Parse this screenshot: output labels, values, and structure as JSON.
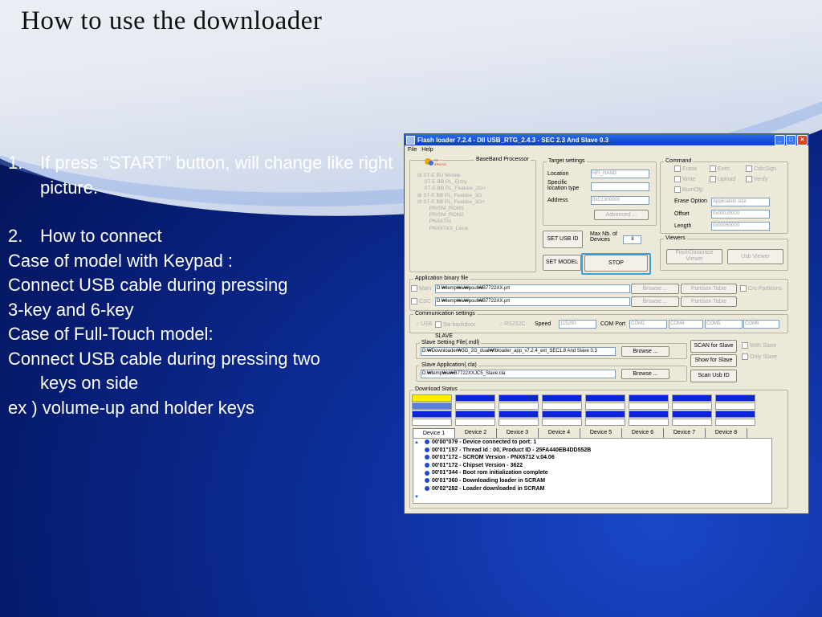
{
  "slide": {
    "title": "How to use the downloader",
    "item1_num": "1.",
    "item1_text": "If press “START” button, will change like right picture.",
    "item2_num": "2.",
    "item2_text": "How to connect",
    "lines": [
      "Case of model with Keypad :",
      "Connect USB cable during pressing",
      "3-key and 6-key",
      "Case of Full-Touch model:",
      "Connect USB cable during pressing two"
    ],
    "line_indent": "keys on side",
    "line_last": "ex ) volume-up and holder keys"
  },
  "window": {
    "title": "Flash loader 7.2.4 - Dll USB_RTG_2.4.3 - SEC 2.3 And Slave 0.3",
    "menu": [
      "File",
      "Help"
    ],
    "logo_text": "ST ERICSSON",
    "baseband_label": "BaseBand Processor",
    "tree": [
      "⊟ ST-E BU Mobile",
      "  ST-E BB PL_Entry",
      "  ST-E BB PL_Feature_2G+",
      "⊞ ST-E BB PL_Feature_3G",
      "⊟ ST-E BB PL_Feature_3G+",
      "   PRISM_ROM1",
      "   PRISM_ROM2",
      "   PNX6701",
      "   PNX67XX_Linux"
    ],
    "target": {
      "label": "Target settings",
      "location_label": "Location",
      "location_value": "NFI_NAND",
      "specific_label": "Specific location type",
      "address_label": "Address",
      "address_value": "0xC1300000",
      "advanced": "Advanced ..."
    },
    "command": {
      "label": "Command",
      "erase": "Erase",
      "exec": "Exec",
      "calcsign": "CalcSign",
      "write": "Write",
      "upload": "Upload",
      "verify": "Verify",
      "burnotp": "BurnOtp",
      "erase_option_label": "Erase Option",
      "erase_option_value": "Application size",
      "offset_label": "Offset",
      "offset_value": "0x00020000",
      "length_label": "Length",
      "length_value": "0x00060000"
    },
    "set_usb_id": "SET USB ID",
    "max_devices_label": "Max Nb. of Devices",
    "max_devices_value": "8",
    "set_model": "SET MODEL",
    "stop": "STOP",
    "viewers": {
      "label": "Viewers",
      "flash_db": "FlashDatabase Viewer",
      "usb_viewer": "Usb Viewer"
    },
    "app_binary": {
      "label": "Application binary file",
      "main_label": "Main",
      "main_path": "D:₩temp₩a₩pout₩B7722XX.prt",
      "csc_label": "CSC",
      "csc_path": "D:₩temp₩a₩pout₩B7722XX.prt",
      "browse": "Browse ...",
      "partition_table": "Partition Table",
      "crc": "Crc Partitions"
    },
    "comm": {
      "label": "Communication settings",
      "usb": "USB",
      "sw_backdoor": "Sw backdoor",
      "rs232c": "RS232C",
      "speed_label": "Speed",
      "speed_value": "115200",
      "com_port_label": "COM Port",
      "ports": [
        "COM1",
        "COM4",
        "COM5",
        "COM6"
      ]
    },
    "slave": {
      "label": "SLAVE",
      "setting_label": "Slave Setting File(.mdl)",
      "setting_path": "D:₩Downloader₩3G_2G_dual₩fbloader_app_v7.2.4_ext_SEC1.8 And Slave 0.3",
      "app_label": "Slave Application(.cla)",
      "app_path": "D:₩temp₩a₩B7722XXJC5_Slave.cla",
      "browse": "Browse ...",
      "scan_for_slave": "SCAN for Slave",
      "show_for_slave": "Show for Slave",
      "scan_usb_id": "Scan Usb ID",
      "with_slave": "With Slave",
      "only_slave": "Only Slave"
    },
    "download_status_label": "Download Status",
    "progress": {
      "row1": [
        "yellow",
        "blue",
        "blue",
        "blue",
        "blue",
        "blue",
        "blue",
        "blue"
      ],
      "row2": [
        "lblue",
        "empty",
        "empty",
        "empty",
        "empty",
        "empty",
        "empty",
        "empty"
      ],
      "row3": [
        "blue",
        "blue",
        "blue",
        "blue",
        "blue",
        "blue",
        "blue",
        "blue"
      ],
      "row4": [
        "empty",
        "empty",
        "empty",
        "empty",
        "empty",
        "empty",
        "empty",
        "empty"
      ]
    },
    "tabs": [
      "Device 1",
      "Device 2",
      "Device 3",
      "Device 4",
      "Device 5",
      "Device 6",
      "Device 7",
      "Device 8"
    ],
    "log": [
      "00'00\"079 - Device connected to port: 1",
      "00'01\"157 - Thread Id : 00, Product ID - 25FA440EB4DD552B",
      "00'01\"172 - SCROM Version - PNX6712 v.04.06",
      "00'01\"172 - Chipset Version - 3622",
      "00'01\"344 - Boot rom initialization complete",
      "00'01\"360 - Downloading loader in SCRAM",
      "00'02\"282 - Loader downloaded in SCRAM"
    ]
  }
}
